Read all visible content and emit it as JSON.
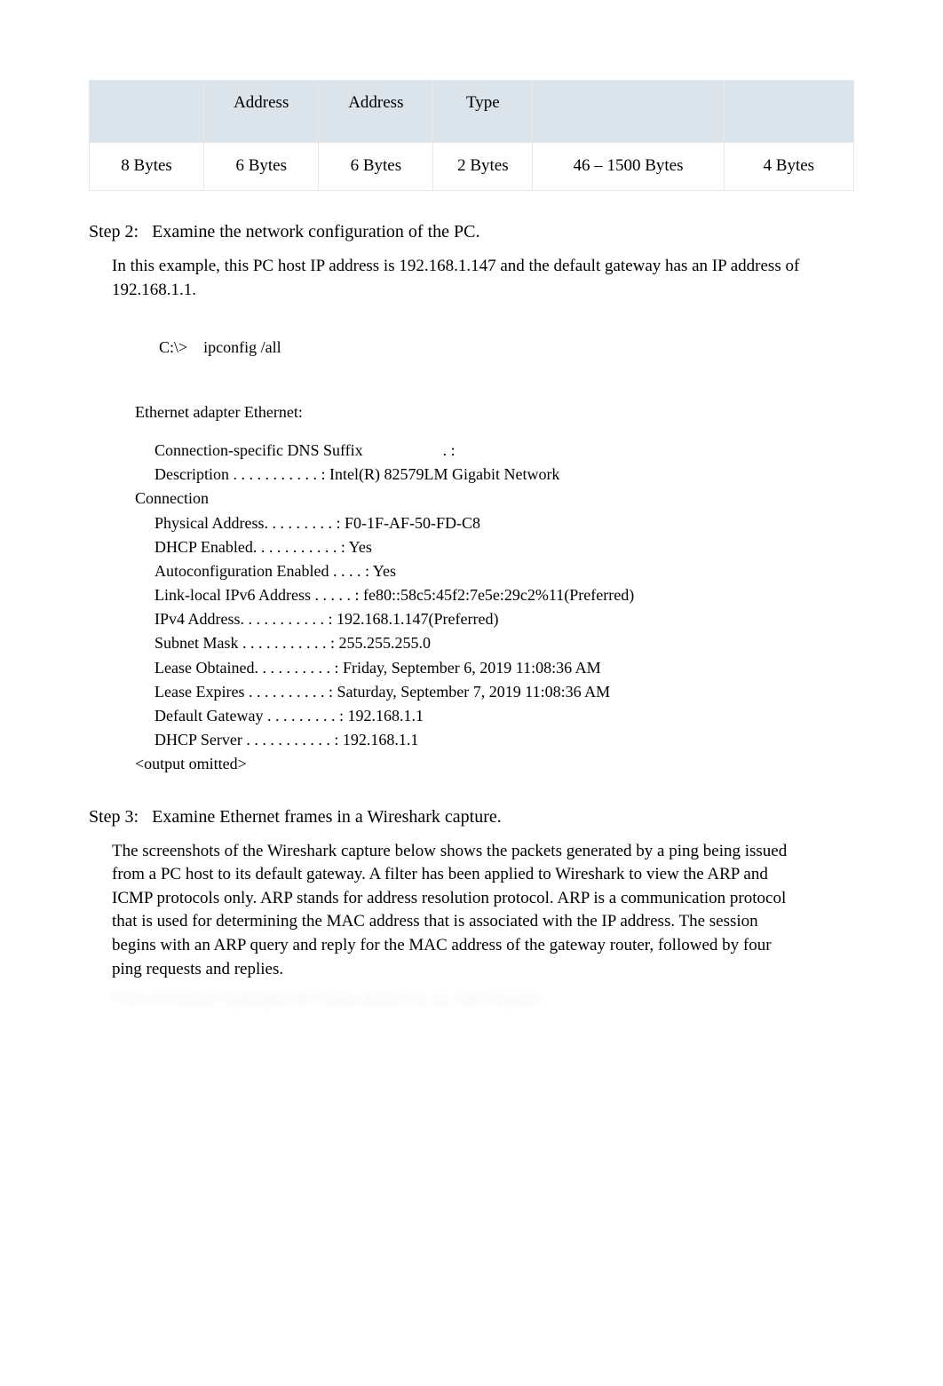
{
  "frame_table": {
    "headers": [
      "",
      "Address",
      "Address",
      "Type",
      "",
      ""
    ],
    "row": [
      "8 Bytes",
      "6 Bytes",
      "6 Bytes",
      "2 Bytes",
      "46 – 1500 Bytes",
      "4 Bytes"
    ]
  },
  "step2": {
    "heading_label": "Step 2:",
    "heading_text": "Examine the network configuration of the PC.",
    "intro": "In this example, this PC host IP address is 192.168.1.147 and the default gateway has an IP address of 192.168.1.1.",
    "cmd_prompt": "C:\\>",
    "cmd_text": "ipconfig /all",
    "adapter_line": "Ethernet adapter Ethernet:",
    "lines": [
      "Connection-specific DNS Suffix                    . :",
      "Description . . . . . . . . . . . : Intel(R) 82579LM Gigabit Network",
      "Physical Address. . . . . . . . . : F0-1F-AF-50-FD-C8",
      "DHCP Enabled. . . . . . . . . . . : Yes",
      "Autoconfiguration Enabled . . . . : Yes",
      "Link-local IPv6 Address . . . . . : fe80::58c5:45f2:7e5e:29c2%11(Preferred)",
      "IPv4 Address. . . . . . . . . . . : 192.168.1.147(Preferred)",
      "Subnet Mask . . . . . . . . . . . : 255.255.255.0",
      "Lease Obtained. . . . . . . . . . : Friday, September 6, 2019 11:08:36 AM",
      "Lease Expires . . . . . . . . . . : Saturday, September 7, 2019 11:08:36 AM",
      "Default Gateway . . . . . . . . . : 192.168.1.1",
      "DHCP Server . . . . . . . . . . . : 192.168.1.1"
    ],
    "desc_wrap": "Connection",
    "omitted": "<output omitted>"
  },
  "step3": {
    "heading_label": "Step 3:",
    "heading_text": "Examine Ethernet frames in a Wireshark capture.",
    "para": "The screenshots of the Wireshark capture below shows the packets generated by a ping being issued from a PC host to its default gateway. A filter has been applied to Wireshark to view the ARP and ICMP protocols only. ARP stands for address resolution protocol. ARP is a communication protocol that is used for determining the MAC address that is associated with the IP address. The session begins with an ARP query and reply for the MAC address of the gateway router, followed by four ping requests and replies.",
    "blurred": "This screenshot highlights the frame details for an ARP request."
  }
}
